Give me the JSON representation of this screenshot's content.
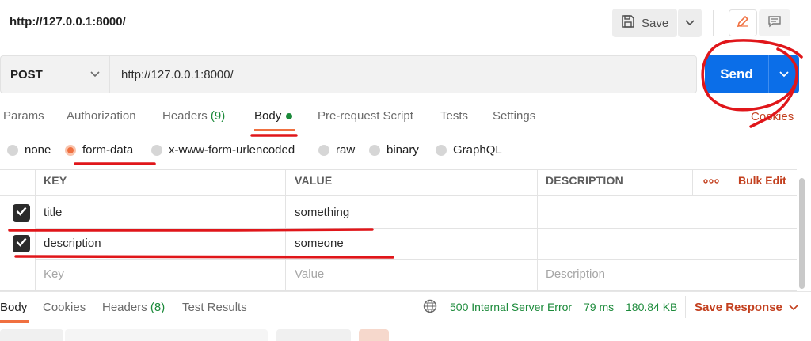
{
  "header": {
    "tab_title": "http://127.0.0.1:8000/",
    "save_label": "Save"
  },
  "request": {
    "method": "POST",
    "url": "http://127.0.0.1:8000/",
    "send_label": "Send"
  },
  "request_tabs": {
    "params": "Params",
    "authorization": "Authorization",
    "headers": "Headers",
    "headers_count": "(9)",
    "body": "Body",
    "prerequest": "Pre-request Script",
    "tests": "Tests",
    "settings": "Settings",
    "cookies": "Cookies"
  },
  "body_types": {
    "none": "none",
    "form_data": "form-data",
    "urlencoded": "x-www-form-urlencoded",
    "raw": "raw",
    "binary": "binary",
    "graphql": "GraphQL",
    "selected": "form-data"
  },
  "form_table": {
    "headers": {
      "key": "KEY",
      "value": "VALUE",
      "description": "DESCRIPTION",
      "bulk_edit": "Bulk Edit"
    },
    "rows": [
      {
        "key": "title",
        "value": "something",
        "description": "",
        "checked": true
      },
      {
        "key": "description",
        "value": "someone",
        "description": "",
        "checked": true
      }
    ],
    "placeholders": {
      "key": "Key",
      "value": "Value",
      "description": "Description"
    }
  },
  "response_tabs": {
    "body": "Body",
    "cookies": "Cookies",
    "headers": "Headers",
    "headers_count": "(8)",
    "test_results": "Test Results"
  },
  "response_status": {
    "status": "500 Internal Server Error",
    "time": "79 ms",
    "size": "180.84 KB",
    "save_response": "Save Response"
  },
  "colors": {
    "accent": "#f07040",
    "send_blue": "#0b6ee8",
    "status_green": "#1b8a3a",
    "link_orange": "#c3401f",
    "annotation_red": "#e0161a"
  },
  "icons": [
    "save-icon",
    "chevron-down-icon",
    "pencil-icon",
    "comment-icon",
    "globe-icon",
    "more-dots-icon",
    "checkbox-checked-icon"
  ]
}
